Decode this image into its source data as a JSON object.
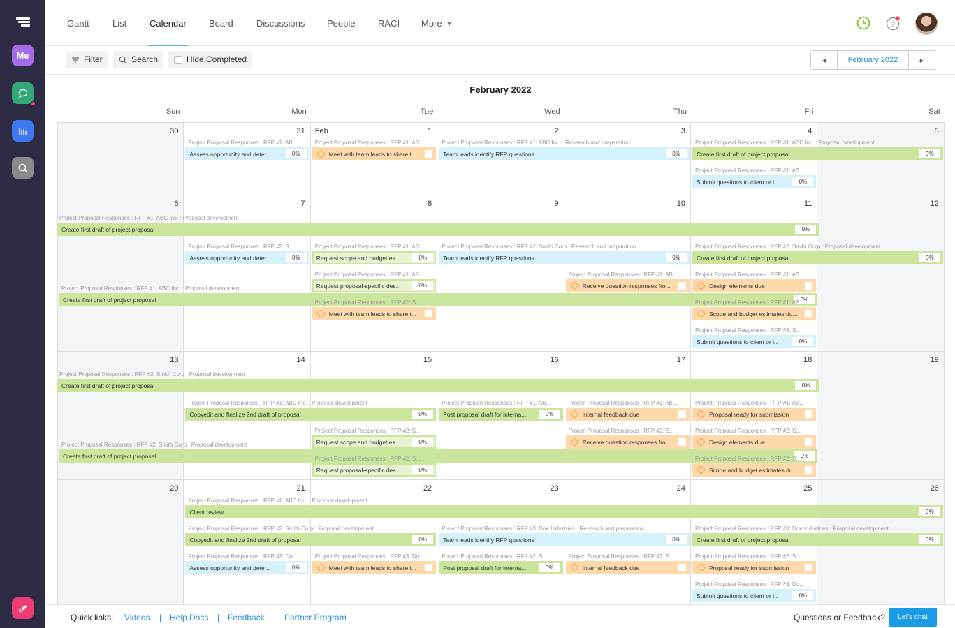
{
  "rail": {
    "me_label": "Me",
    "colors": {
      "me": "#a66ce8",
      "chat": "#35a87a",
      "reports": "#3e79f1",
      "search": "#8a8a8a",
      "rocket": "#ee3d74"
    }
  },
  "nav": {
    "tabs": [
      {
        "label": "Gantt"
      },
      {
        "label": "List"
      },
      {
        "label": "Calendar"
      },
      {
        "label": "Board"
      },
      {
        "label": "Discussions"
      },
      {
        "label": "People"
      },
      {
        "label": "RACI"
      },
      {
        "label": "More"
      }
    ],
    "active_tab": "Calendar"
  },
  "toolbar": {
    "filter_label": "Filter",
    "search_label": "Search",
    "hide_completed_label": "Hide Completed",
    "month_label": "February 2022",
    "prev_icon": "◂",
    "next_icon": "▸"
  },
  "calendar": {
    "title": "February 2022",
    "weekdays": [
      "Sun",
      "Mon",
      "Tue",
      "Wed",
      "Thu",
      "Fri",
      "Sat"
    ],
    "weeks": [
      {
        "days": [
          {
            "n": "30"
          },
          {
            "n": "31"
          },
          {
            "n": "1",
            "month": "Feb"
          },
          {
            "n": "2"
          },
          {
            "n": "3"
          },
          {
            "n": "4"
          },
          {
            "n": "5"
          }
        ],
        "events": [
          {
            "col": 1,
            "span": 1,
            "lane": 0,
            "kind": "blue",
            "crumb": "Project Proposal Responses : RFP #1: AB...",
            "label": "Assess opportunity and deter...",
            "pct": "0%"
          },
          {
            "col": 2,
            "span": 1,
            "lane": 0,
            "kind": "orange",
            "crumb": "Project Proposal Responses : RFP #1: AB...",
            "label": "Meet with team leads to share t..."
          },
          {
            "col": 3,
            "span": 2,
            "lane": 0,
            "kind": "blue",
            "crumb": "Project Proposal Responses : RFP #1: ABC Inc. : Research and preparation",
            "label": "Team leads identify RFP questions",
            "pct": "0%"
          },
          {
            "col": 5,
            "span": 2,
            "lane": 0,
            "kind": "green",
            "crumb": "Project Proposal Responses : RFP #1: ABC Inc. : Proposal development",
            "label": "Create first draft of project proposal",
            "pct": "0%"
          },
          {
            "col": 5,
            "span": 1,
            "lane": 1,
            "kind": "blue",
            "crumb": "Project Proposal Responses : RFP #1: AB...",
            "label": "Submit questions to client or i...",
            "pct": "0%"
          }
        ]
      },
      {
        "days": [
          {
            "n": "6"
          },
          {
            "n": "7"
          },
          {
            "n": "8"
          },
          {
            "n": "9"
          },
          {
            "n": "10"
          },
          {
            "n": "11"
          },
          {
            "n": "12"
          }
        ],
        "full": {
          "crumb": "Project Proposal Responses : RFP #1: ABC Inc. : Proposal development",
          "label": "Create first draft of project proposal",
          "pct": "0%",
          "span": 6
        },
        "events": [
          {
            "col": 1,
            "span": 1,
            "lane": 0,
            "kind": "blue",
            "crumb": "Project Proposal Responses : RFP #2: S...",
            "label": "Assess opportunity and deter...",
            "pct": "0%"
          },
          {
            "col": 2,
            "span": 1,
            "lane": 0,
            "kind": "outline",
            "crumb": "Project Proposal Responses : RFP #1: AB...",
            "label": "Request scope and budget es...",
            "pct": "0%"
          },
          {
            "col": 3,
            "span": 2,
            "lane": 0,
            "kind": "blue",
            "crumb": "Project Proposal Responses : RFP #2: Smith Corp : Research and preparation",
            "label": "Team leads identify RFP questions",
            "pct": "0%"
          },
          {
            "col": 5,
            "span": 2,
            "lane": 0,
            "kind": "green",
            "crumb": "Project Proposal Responses : RFP #2: Smith Corp : Proposal development",
            "label": "Create first draft of project proposal",
            "pct": "0%"
          },
          {
            "col": 2,
            "span": 1,
            "lane": 1,
            "kind": "outline",
            "crumb": "Project Proposal Responses : RFP #1: AB...",
            "label": "Request proposal-specific des...",
            "pct": "0%"
          },
          {
            "col": 4,
            "span": 1,
            "lane": 1,
            "kind": "orange",
            "crumb": "Project Proposal Responses : RFP #1: AB...",
            "label": "Receive question responses fro..."
          },
          {
            "col": 5,
            "span": 1,
            "lane": 1,
            "kind": "orange",
            "crumb": "Project Proposal Responses : RFP #1: AB...",
            "label": "Design elements due"
          },
          {
            "col": 2,
            "span": 1,
            "lane": 2,
            "kind": "orange",
            "crumb": "Project Proposal Responses : RFP #2: S...",
            "label": "Meet with team leads to share t..."
          },
          {
            "col": 5,
            "span": 1,
            "lane": 2,
            "kind": "orange",
            "crumb": "Project Proposal Responses : RFP #1: AB...",
            "label": "Scope and budget estimates du..."
          },
          {
            "col": 5,
            "span": 1,
            "lane": 3,
            "kind": "blue",
            "crumb": "Project Proposal Responses : RFP #2: S...",
            "label": "Submit questions to client or i...",
            "pct": "0%"
          }
        ]
      },
      {
        "days": [
          {
            "n": "13"
          },
          {
            "n": "14"
          },
          {
            "n": "15"
          },
          {
            "n": "16"
          },
          {
            "n": "17"
          },
          {
            "n": "18"
          },
          {
            "n": "19"
          }
        ],
        "full": {
          "crumb": "Project Proposal Responses : RFP #2: Smith Corp : Proposal development",
          "label": "Create first draft of project proposal",
          "pct": "0%",
          "span": 6
        },
        "events": [
          {
            "col": 1,
            "span": 2,
            "lane": 0,
            "kind": "green",
            "crumb": "Project Proposal Responses : RFP #1: ABC Inc. : Proposal development",
            "label": "Copyedit and finalize 2nd draft of proposal",
            "pct": "0%"
          },
          {
            "col": 3,
            "span": 1,
            "lane": 0,
            "kind": "green",
            "crumb": "Project Proposal Responses : RFP #1: AB...",
            "label": "Post proposal draft for interna...",
            "pct": "0%"
          },
          {
            "col": 4,
            "span": 1,
            "lane": 0,
            "kind": "orange",
            "crumb": "Project Proposal Responses : RFP #1: AB...",
            "label": "Internal feedback due"
          },
          {
            "col": 5,
            "span": 1,
            "lane": 0,
            "kind": "orange",
            "crumb": "Project Proposal Responses : RFP #1: AB...",
            "label": "Proposal ready for submission"
          },
          {
            "col": 2,
            "span": 1,
            "lane": 1,
            "kind": "outline",
            "crumb": "Project Proposal Responses : RFP #2: S...",
            "label": "Request scope and budget es...",
            "pct": "0%"
          },
          {
            "col": 4,
            "span": 1,
            "lane": 1,
            "kind": "orange",
            "crumb": "Project Proposal Responses : RFP #2: S...",
            "label": "Receive question responses fro..."
          },
          {
            "col": 5,
            "span": 1,
            "lane": 1,
            "kind": "orange",
            "crumb": "Project Proposal Responses : RFP #2: S...",
            "label": "Design elements due"
          },
          {
            "col": 2,
            "span": 1,
            "lane": 2,
            "kind": "outline",
            "crumb": "Project Proposal Responses : RFP #2: S...",
            "label": "Request proposal-specific des...",
            "pct": "0%"
          },
          {
            "col": 5,
            "span": 1,
            "lane": 2,
            "kind": "orange",
            "crumb": "Project Proposal Responses : RFP #2: S...",
            "label": "Scope and budget estimates du..."
          }
        ]
      },
      {
        "days": [
          {
            "n": "20"
          },
          {
            "n": "21"
          },
          {
            "n": "22"
          },
          {
            "n": "23"
          },
          {
            "n": "24"
          },
          {
            "n": "25"
          },
          {
            "n": "26"
          }
        ],
        "events": [
          {
            "col": 1,
            "span": 6,
            "lane": 0,
            "kind": "green",
            "crumb": "Project Proposal Responses : RFP #1: ABC Inc. : Proposal development",
            "label": "Client review",
            "pct": "0%"
          },
          {
            "col": 1,
            "span": 2,
            "lane": 1,
            "kind": "green",
            "crumb": "Project Proposal Responses : RFP #2: Smith Corp : Proposal development",
            "label": "Copyedit and finalize 2nd draft of proposal",
            "pct": "0%"
          },
          {
            "col": 3,
            "span": 2,
            "lane": 1,
            "kind": "blue",
            "crumb": "Project Proposal Responses : RFP #3: Doe Industries : Research and preparation",
            "label": "Team leads identify RFP questions",
            "pct": "0%"
          },
          {
            "col": 5,
            "span": 2,
            "lane": 1,
            "kind": "green",
            "crumb": "Project Proposal Responses : RFP #3: Doe Industries : Proposal development",
            "label": "Create first draft of project proposal",
            "pct": "0%"
          },
          {
            "col": 1,
            "span": 1,
            "lane": 2,
            "kind": "blue",
            "crumb": "Project Proposal Responses : RFP #3: Do...",
            "label": "Assess opportunity and deter...",
            "pct": "0%"
          },
          {
            "col": 2,
            "span": 1,
            "lane": 2,
            "kind": "orange",
            "crumb": "Project Proposal Responses : RFP #3: Do...",
            "label": "Meet with team leads to share t..."
          },
          {
            "col": 3,
            "span": 1,
            "lane": 2,
            "kind": "green",
            "crumb": "Project Proposal Responses : RFP #2: S...",
            "label": "Post proposal draft for interna...",
            "pct": "0%"
          },
          {
            "col": 4,
            "span": 1,
            "lane": 2,
            "kind": "orange",
            "crumb": "Project Proposal Responses : RFP #2: S...",
            "label": "Internal feedback due"
          },
          {
            "col": 5,
            "span": 1,
            "lane": 2,
            "kind": "orange",
            "crumb": "Project Proposal Responses : RFP #2: S...",
            "label": "Proposal ready for submission"
          },
          {
            "col": 5,
            "span": 1,
            "lane": 3,
            "kind": "blue",
            "crumb": "Project Proposal Responses : RFP #3: Do...",
            "label": "Submit questions to client or i...",
            "pct": "0%"
          }
        ]
      }
    ]
  },
  "footer": {
    "quick_links_label": "Quick links:",
    "links": [
      {
        "label": "Videos"
      },
      {
        "label": "Help Docs"
      },
      {
        "label": "Feedback"
      },
      {
        "label": "Partner Program"
      }
    ],
    "separator": "|",
    "questions_label": "Questions or Feedback?",
    "chat_button": "Let's chat"
  }
}
